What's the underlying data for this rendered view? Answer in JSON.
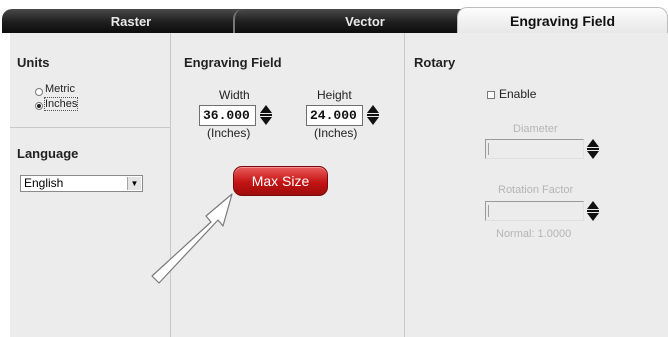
{
  "tabs": {
    "raster": "Raster",
    "vector": "Vector",
    "engraving": "Engraving Field"
  },
  "units": {
    "header": "Units",
    "metric": "Metric",
    "inches": "Inches",
    "selected": "inches"
  },
  "language": {
    "header": "Language",
    "selected": "English"
  },
  "engraving_field": {
    "header": "Engraving Field",
    "width_label": "Width",
    "width_value": "36.000",
    "width_unit": "(Inches)",
    "height_label": "Height",
    "height_value": "24.000",
    "height_unit": "(Inches)",
    "max_size_label": "Max Size"
  },
  "rotary": {
    "header": "Rotary",
    "enable_label": "Enable",
    "diameter_label": "Diameter",
    "rotation_factor_label": "Rotation Factor",
    "normal_label": "Normal: 1.0000"
  },
  "colors": {
    "max_size_button": "#c41414",
    "active_tab": "#f2f2f2",
    "dark_tab": "#1e1e1e",
    "panel_bg": "#ececec"
  },
  "icons": {
    "spinner": "up-down-spinner-icon",
    "dropdown": "dropdown-arrow-icon",
    "annotation": "pointer-arrow-icon"
  }
}
